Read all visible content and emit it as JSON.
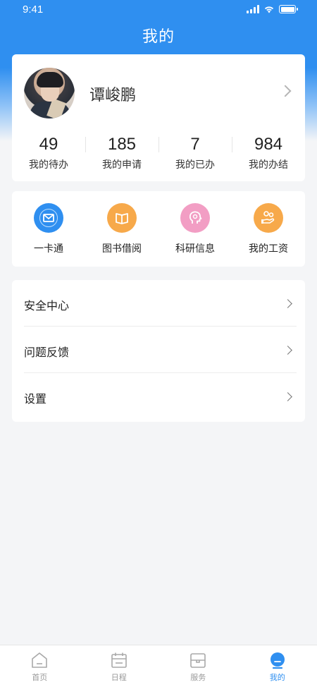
{
  "status_bar": {
    "time": "9:41"
  },
  "header": {
    "title": "我的"
  },
  "profile": {
    "name": "谭峻鹏"
  },
  "stats": [
    {
      "value": "49",
      "label": "我的待办"
    },
    {
      "value": "185",
      "label": "我的申请"
    },
    {
      "value": "7",
      "label": "我的已办"
    },
    {
      "value": "984",
      "label": "我的办结"
    }
  ],
  "apps": [
    {
      "label": "一卡通",
      "icon": "envelope-icon",
      "color": "#2f8ff0"
    },
    {
      "label": "图书借阅",
      "icon": "book-icon",
      "color": "#f7a94a"
    },
    {
      "label": "科研信息",
      "icon": "head-icon",
      "color": "#f29ec4"
    },
    {
      "label": "我的工资",
      "icon": "wage-icon",
      "color": "#f7a94a"
    }
  ],
  "menu": [
    {
      "label": "安全中心"
    },
    {
      "label": "问题反馈"
    },
    {
      "label": "设置"
    }
  ],
  "tabbar": [
    {
      "label": "首页",
      "icon": "home-icon",
      "active": false
    },
    {
      "label": "日程",
      "icon": "calendar-icon",
      "active": false
    },
    {
      "label": "服务",
      "icon": "service-icon",
      "active": false
    },
    {
      "label": "我的",
      "icon": "profile-icon",
      "active": true
    }
  ],
  "colors": {
    "primary": "#2f8ff0",
    "background": "#f4f5f7"
  }
}
